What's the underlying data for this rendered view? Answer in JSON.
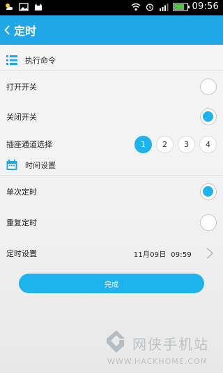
{
  "statusbar": {
    "time": "09:56"
  },
  "header": {
    "title": "定时"
  },
  "sections": {
    "command": {
      "label": "执行命令"
    },
    "time": {
      "label": "时间设置"
    }
  },
  "rows": {
    "open_switch": {
      "label": "打开开关",
      "selected": false
    },
    "close_switch": {
      "label": "关闭开关",
      "selected": true
    },
    "channel_select": {
      "label": "插座通道选择",
      "options": [
        "1",
        "2",
        "3",
        "4"
      ],
      "selected": "1"
    },
    "single_timer": {
      "label": "单次定时",
      "selected": true
    },
    "repeat_timer": {
      "label": "重复定时",
      "selected": false
    },
    "timer_setting": {
      "label": "定时设置",
      "value": "11月09日  09:59"
    }
  },
  "done_button": {
    "label": "完成"
  },
  "watermark": {
    "cn": "网侠手机站",
    "url": "WWW.HACKHOME.COM"
  },
  "colors": {
    "accent": "#1fb3ee",
    "header": "#1fa7e7"
  }
}
